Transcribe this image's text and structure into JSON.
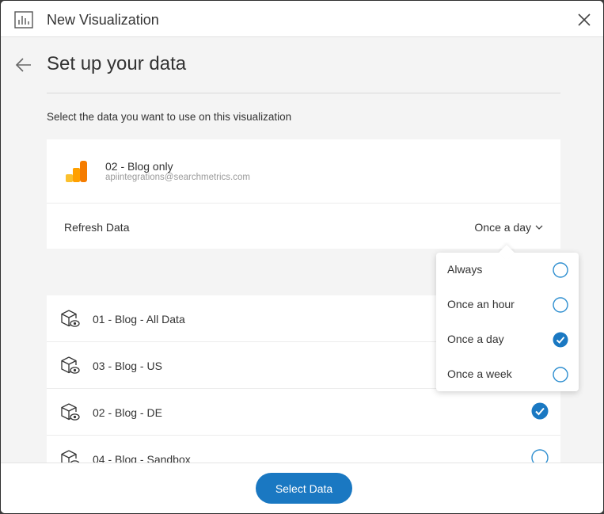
{
  "header": {
    "title": "New Visualization",
    "icon": "bar-chart-icon"
  },
  "page": {
    "title": "Set up your data",
    "instruction": "Select the data you want to use on this visualization"
  },
  "source": {
    "name": "02 - Blog only",
    "account": "apiintegrations@searchmetrics.com",
    "logo": "google-analytics-icon",
    "refresh_label": "Refresh Data",
    "refresh_value": "Once a day"
  },
  "refresh_options": [
    {
      "label": "Always",
      "selected": false
    },
    {
      "label": "Once an hour",
      "selected": false
    },
    {
      "label": "Once a day",
      "selected": true
    },
    {
      "label": "Once a week",
      "selected": false
    }
  ],
  "datasets": [
    {
      "label": "01 - Blog - All Data",
      "selected": false
    },
    {
      "label": "03 - Blog - US",
      "selected": false
    },
    {
      "label": "02 - Blog - DE",
      "selected": true
    },
    {
      "label": "04 - Blog - Sandbox",
      "selected": false
    }
  ],
  "footer": {
    "primary_label": "Select Data"
  },
  "colors": {
    "accent": "#1a78c2",
    "radio_border": "#2f8fd0",
    "logo_orange": "#f57c00",
    "logo_yellow": "#fbc02d"
  }
}
